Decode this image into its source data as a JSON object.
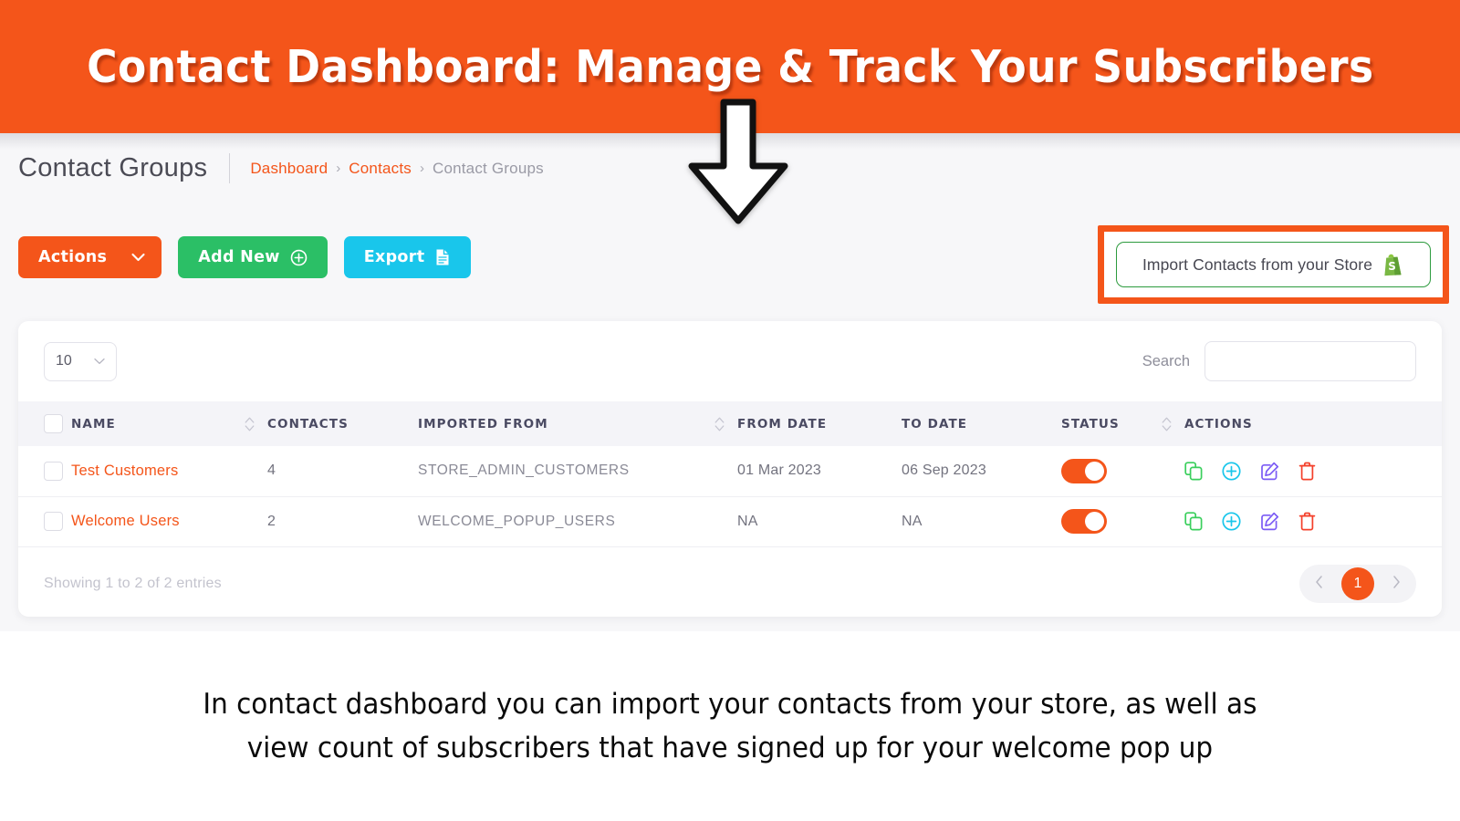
{
  "banner": {
    "title": "Contact Dashboard: Manage & Track Your Subscribers",
    "background_color": "#F4551A",
    "text_color": "#FFFFFF"
  },
  "annotation": {
    "arrow_icon": "down-arrow-icon",
    "highlight_box_color": "#F4551A"
  },
  "header": {
    "page_title": "Contact Groups",
    "breadcrumb": [
      {
        "label": "Dashboard",
        "is_link": true
      },
      {
        "label": "Contacts",
        "is_link": true
      },
      {
        "label": "Contact Groups",
        "is_link": false
      }
    ],
    "breadcrumb_separator": "›"
  },
  "toolbar": {
    "actions_label": "Actions",
    "actions_icon": "chevron-down-icon",
    "actions_color": "#F4551A",
    "add_new_label": "Add New",
    "add_new_icon": "plus-circle-icon",
    "add_new_color": "#2BBF66",
    "export_label": "Export",
    "export_icon": "document-icon",
    "export_color": "#19C6EB",
    "import_label": "Import Contacts from your Store",
    "import_icon": "shopify-bag-icon",
    "import_border_color": "#2D9B3E"
  },
  "table_controls": {
    "page_length_value": "10",
    "page_length_icon": "chevron-down-icon",
    "search_label": "Search",
    "search_value": "",
    "search_placeholder": ""
  },
  "table": {
    "select_all_checked": false,
    "columns": [
      {
        "key": "checkbox",
        "label": "",
        "sortable": false
      },
      {
        "key": "name",
        "label": "NAME",
        "sortable": true
      },
      {
        "key": "contacts",
        "label": "CONTACTS",
        "sortable": false
      },
      {
        "key": "imported_from",
        "label": "IMPORTED FROM",
        "sortable": true
      },
      {
        "key": "from_date",
        "label": "FROM DATE",
        "sortable": false
      },
      {
        "key": "to_date",
        "label": "TO DATE",
        "sortable": false
      },
      {
        "key": "status",
        "label": "STATUS",
        "sortable": true
      },
      {
        "key": "actions",
        "label": "ACTIONS",
        "sortable": false
      }
    ],
    "rows": [
      {
        "checked": false,
        "name": "Test Customers",
        "contacts": "4",
        "imported_from": "STORE_ADMIN_CUSTOMERS",
        "from_date": "01 Mar 2023",
        "to_date": "06 Sep 2023",
        "status_on": true,
        "actions": [
          "copy-icon",
          "plus-circle-icon",
          "edit-icon",
          "trash-icon"
        ]
      },
      {
        "checked": false,
        "name": "Welcome Users",
        "contacts": "2",
        "imported_from": "WELCOME_POPUP_USERS",
        "from_date": "NA",
        "to_date": "NA",
        "status_on": true,
        "actions": [
          "copy-icon",
          "plus-circle-icon",
          "edit-icon",
          "trash-icon"
        ]
      }
    ],
    "action_colors": {
      "copy": "#3ACF5C",
      "add": "#19C6EB",
      "edit": "#7B5BF5",
      "delete": "#F4402B"
    }
  },
  "footer": {
    "entries_text": "Showing 1 to 2 of 2 entries",
    "prev_icon": "chevron-left-icon",
    "next_icon": "chevron-right-icon",
    "current_page": "1",
    "current_page_color": "#F4551A"
  },
  "caption": {
    "line1": "In contact dashboard you can import your contacts from your store, as well as",
    "line2": "view count of subscribers that have signed up for your welcome pop up"
  }
}
